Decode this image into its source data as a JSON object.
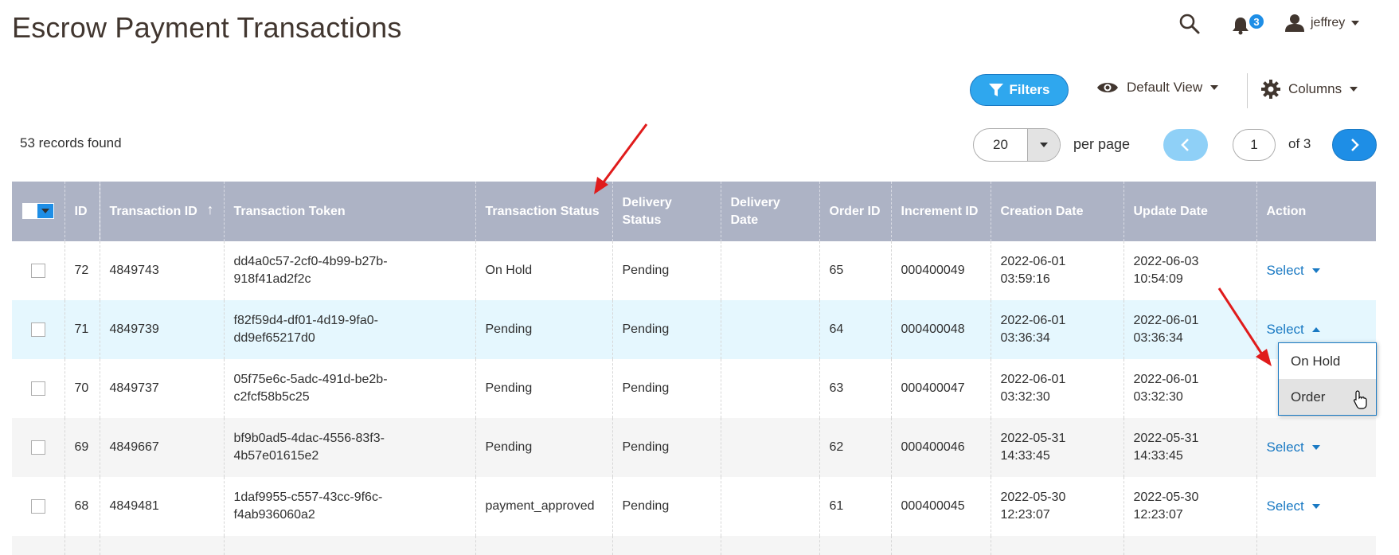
{
  "page": {
    "title": "Escrow Payment Transactions"
  },
  "header": {
    "notifications_count": "3",
    "user_name": "jeffrey"
  },
  "toolbar": {
    "filters_label": "Filters",
    "view_label": "Default View",
    "columns_label": "Columns",
    "records_found": "53 records found",
    "per_page_value": "20",
    "per_page_label": "per page",
    "current_page": "1",
    "of_pages": "of 3"
  },
  "table": {
    "headers": {
      "id": "ID",
      "transaction_id": "Transaction ID",
      "transaction_token": "Transaction Token",
      "transaction_status": "Transaction Status",
      "delivery_status": "Delivery Status",
      "delivery_date": "Delivery Date",
      "order_id": "Order ID",
      "increment_id": "Increment ID",
      "creation_date": "Creation Date",
      "update_date": "Update Date",
      "action": "Action"
    },
    "sort_indicator": "↑",
    "select_label": "Select",
    "rows": [
      {
        "id": "72",
        "transaction_id": "4849743",
        "token_1": "dd4a0c57-2cf0-4b99-b27b-",
        "token_2": "918f41ad2f2c",
        "status": "On Hold",
        "delivery_status": "Pending",
        "delivery_date": "",
        "order_id": "65",
        "increment_id": "000400049",
        "created_1": "2022-06-01",
        "created_2": "03:59:16",
        "updated_1": "2022-06-03",
        "updated_2": "10:54:09"
      },
      {
        "id": "71",
        "transaction_id": "4849739",
        "token_1": "f82f59d4-df01-4d19-9fa0-",
        "token_2": "dd9ef65217d0",
        "status": "Pending",
        "delivery_status": "Pending",
        "delivery_date": "",
        "order_id": "64",
        "increment_id": "000400048",
        "created_1": "2022-06-01",
        "created_2": "03:36:34",
        "updated_1": "2022-06-01",
        "updated_2": "03:36:34"
      },
      {
        "id": "70",
        "transaction_id": "4849737",
        "token_1": "05f75e6c-5adc-491d-be2b-",
        "token_2": "c2fcf58b5c25",
        "status": "Pending",
        "delivery_status": "Pending",
        "delivery_date": "",
        "order_id": "63",
        "increment_id": "000400047",
        "created_1": "2022-06-01",
        "created_2": "03:32:30",
        "updated_1": "2022-06-01",
        "updated_2": "03:32:30"
      },
      {
        "id": "69",
        "transaction_id": "4849667",
        "token_1": "bf9b0ad5-4dac-4556-83f3-",
        "token_2": "4b57e01615e2",
        "status": "Pending",
        "delivery_status": "Pending",
        "delivery_date": "",
        "order_id": "62",
        "increment_id": "000400046",
        "created_1": "2022-05-31",
        "created_2": "14:33:45",
        "updated_1": "2022-05-31",
        "updated_2": "14:33:45"
      },
      {
        "id": "68",
        "transaction_id": "4849481",
        "token_1": "1daf9955-c557-43cc-9f6c-",
        "token_2": "f4ab936060a2",
        "status": "payment_approved",
        "delivery_status": "Pending",
        "delivery_date": "",
        "order_id": "61",
        "increment_id": "000400045",
        "created_1": "2022-05-30",
        "created_2": "12:23:07",
        "updated_1": "2022-05-30",
        "updated_2": "12:23:07"
      }
    ]
  },
  "action_menu": {
    "items": [
      "On Hold",
      "Order"
    ]
  },
  "colors": {
    "accent": "#1e8ee6",
    "header_bg": "#adb3c5",
    "arrow": "#e01b1b"
  },
  "icons": {
    "search": "search-icon",
    "bell": "bell-icon",
    "user": "user-icon",
    "filter": "filter-icon",
    "eye": "eye-icon",
    "gear": "gear-icon"
  }
}
